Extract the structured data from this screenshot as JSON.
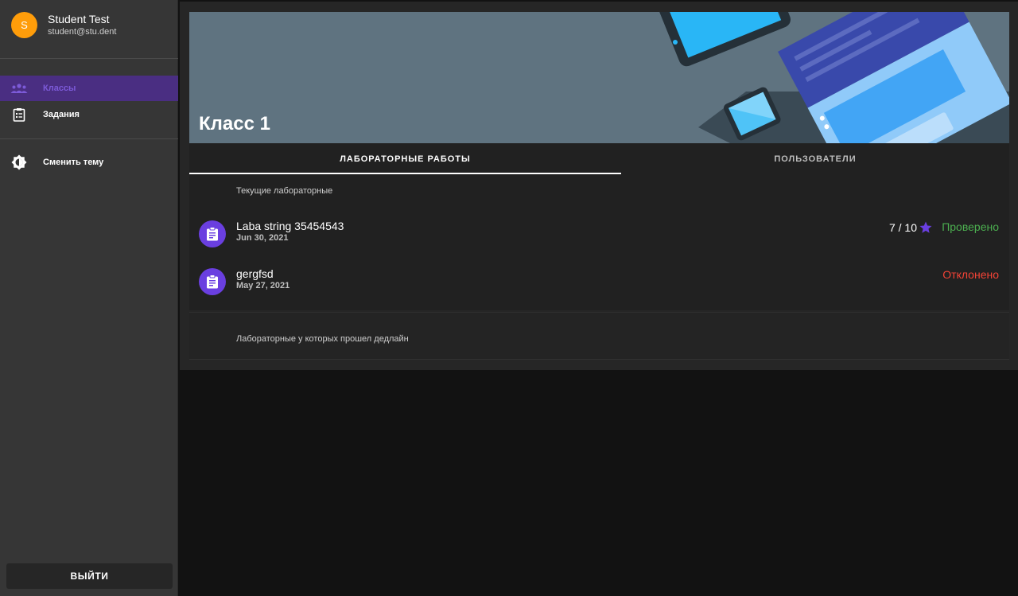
{
  "user": {
    "initial": "S",
    "name": "Student Test",
    "email": "student@stu.dent"
  },
  "nav": {
    "items": [
      {
        "label": "Классы",
        "icon": "groups-icon",
        "active": true
      },
      {
        "label": "Задания",
        "icon": "assignment-icon",
        "active": false
      },
      {
        "label": "Сменить тему",
        "icon": "brightness-icon",
        "active": false
      }
    ],
    "logout_label": "ВЫЙТИ"
  },
  "class": {
    "title": "Класс 1"
  },
  "tabs": [
    {
      "label": "ЛАБОРАТОРНЫЕ РАБОТЫ",
      "active": true
    },
    {
      "label": "ПОЛЬЗОВАТЕЛИ",
      "active": false
    }
  ],
  "current": {
    "section_label": "Текущие лабораторные",
    "labs": [
      {
        "name": "Laba string 35454543",
        "date": "Jun 30, 2021",
        "score": "7 / 10",
        "status": "Проверено",
        "status_color": "#4caf50"
      },
      {
        "name": "gergfsd",
        "date": "May 27, 2021",
        "score": "",
        "status": "Отклонено",
        "status_color": "#f44336"
      }
    ]
  },
  "past": {
    "section_label": "Лабораторные у которых прошел дедлайн"
  },
  "colors": {
    "accent": "#6a3fe0",
    "avatar": "#ff9d0a",
    "success": "#4caf50",
    "error": "#f44336"
  }
}
